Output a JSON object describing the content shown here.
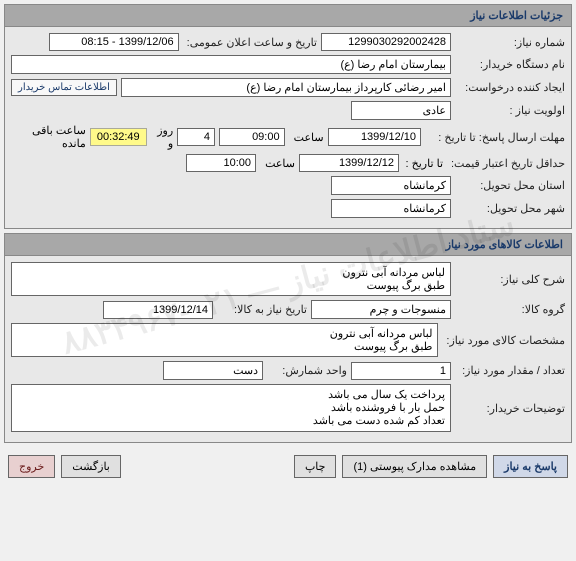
{
  "watermark": "ستاد اطلاعات نیاز — ۰۲۱-۸۸۳۴۹۶۷",
  "section1": {
    "title": "جزئیات اطلاعات نیاز",
    "need_number_label": "شماره نیاز:",
    "need_number": "1299030292002428",
    "announce_label": "تاریخ و ساعت اعلان عمومی:",
    "announce_value": "1399/12/06 - 08:15",
    "buyer_org_label": "نام دستگاه خریدار:",
    "buyer_org": "بیمارستان امام رضا (ع)",
    "requester_label": "ایجاد کننده درخواست:",
    "requester": "امیر رضائی کارپرداز بیمارستان امام رضا (ع)",
    "contact_btn": "اطلاعات تماس خریدار",
    "priority_label": "اولویت نیاز :",
    "priority": "عادی",
    "deadline_label": "مهلت ارسال پاسخ:  تا تاریخ :",
    "deadline_date": "1399/12/10",
    "time_label": "ساعت",
    "deadline_time": "09:00",
    "days_label": "روز و",
    "days_value": "4",
    "countdown": "00:32:49",
    "remaining_label": "ساعت باقی مانده",
    "min_credit_label": "حداقل تاریخ اعتبار قیمت:",
    "min_credit_sublabel": "تا تاریخ :",
    "min_credit_date": "1399/12/12",
    "min_credit_time": "10:00",
    "deliver_province_label": "استان محل تحویل:",
    "deliver_province": "کرمانشاه",
    "deliver_city_label": "شهر محل تحویل:",
    "deliver_city": "کرمانشاه"
  },
  "section2": {
    "title": "اطلاعات کالاهای مورد نیاز",
    "general_desc_label": "شرح کلی نیاز:",
    "general_desc": "لباس مردانه آبی نترون\nطبق برگ پیوست",
    "product_group_label": "گروه کالا:",
    "product_group": "منسوجات و چرم",
    "need_until_label": "تاریخ نیاز به کالا:",
    "need_until_date": "1399/12/14",
    "product_spec_label": "مشخصات کالای مورد نیاز:",
    "product_spec": "لباس مردانه آبی نترون\nطبق برگ پیوست",
    "quantity_label": "تعداد / مقدار مورد نیاز:",
    "quantity": "1",
    "unit_label": "واحد شمارش:",
    "unit": "دست",
    "buyer_notes_label": "توضیحات خریدار:",
    "buyer_notes": "پرداخت یک سال می باشد\nحمل بار با فروشنده باشد\nتعداد کم شده دست می باشد"
  },
  "footer": {
    "respond": "پاسخ به نیاز",
    "attachments": "مشاهده مدارک پیوستی (1)",
    "print": "چاپ",
    "back": "بازگشت",
    "exit": "خروج"
  }
}
